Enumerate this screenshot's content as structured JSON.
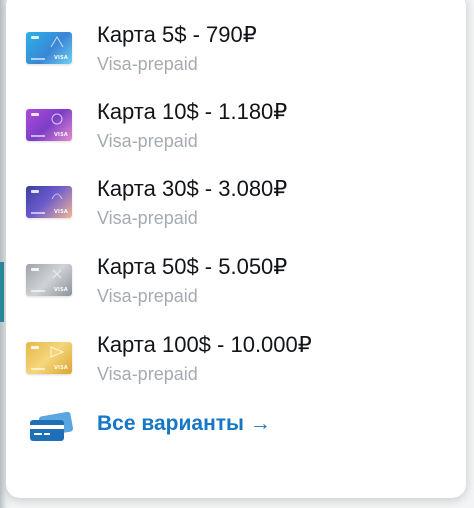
{
  "colors": {
    "title": "#111418",
    "subtitle": "#a5abb1",
    "link": "#1577c5",
    "panel": "#ffffff"
  },
  "items": [
    {
      "title": "Карта 5$ - 790₽",
      "subtitle": "Visa-prepaid",
      "icon": "blue-card-icon"
    },
    {
      "title": "Карта 10$ - 1.180₽",
      "subtitle": "Visa-prepaid",
      "icon": "purple-card-icon"
    },
    {
      "title": "Карта 30$ - 3.080₽",
      "subtitle": "Visa-prepaid",
      "icon": "violet-card-icon"
    },
    {
      "title": "Карта 50$ - 5.050₽",
      "subtitle": "Visa-prepaid",
      "icon": "silver-card-icon"
    },
    {
      "title": "Карта 100$ - 10.000₽",
      "subtitle": "Visa-prepaid",
      "icon": "gold-card-icon"
    }
  ],
  "all_variants": {
    "label": "Все варианты →",
    "icon": "cards-stack-icon"
  }
}
